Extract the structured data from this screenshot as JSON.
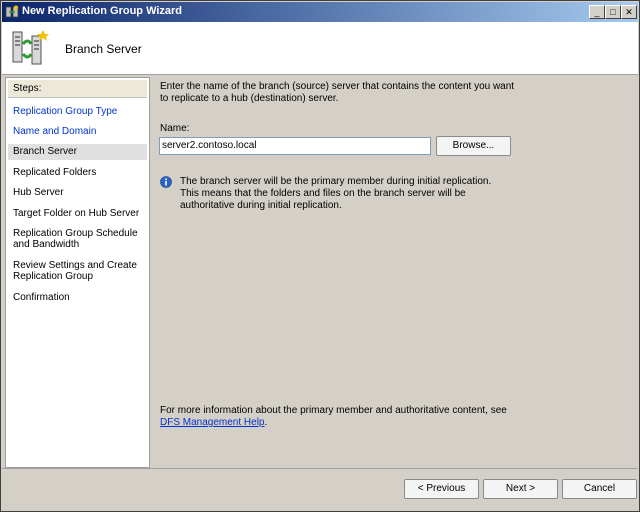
{
  "window": {
    "title": "New Replication Group Wizard",
    "controls": [
      "_",
      "□",
      "✕"
    ]
  },
  "header": {
    "title": "Branch Server",
    "icon": "replication-servers-icon"
  },
  "steps": {
    "heading": "Steps:",
    "items": [
      {
        "label": "Replication Group Type",
        "state": "link"
      },
      {
        "label": "Name and Domain",
        "state": "link"
      },
      {
        "label": "Branch Server",
        "state": "active"
      },
      {
        "label": "Replicated Folders",
        "state": "normal"
      },
      {
        "label": "Hub Server",
        "state": "normal"
      },
      {
        "label": "Target Folder on Hub Server",
        "state": "normal"
      },
      {
        "label": "Replication Group Schedule and Bandwidth",
        "state": "normal"
      },
      {
        "label": "Review Settings and Create Replication Group",
        "state": "normal"
      },
      {
        "label": "Confirmation",
        "state": "normal"
      }
    ]
  },
  "main": {
    "intro": "Enter the name of the branch (source) server that contains the content you want to replicate to a hub (destination) server.",
    "name_label": "Name:",
    "name_value": "server2.contoso.local",
    "browse_label": "Browse...",
    "info_text": "The branch server will be the primary member during initial replication. This means that the folders and files on the branch server will be authoritative during initial replication.",
    "more_info": "For more information about the primary member and authoritative content, see",
    "help_link": "DFS Management Help",
    "help_suffix": "."
  },
  "buttons": {
    "previous": "< Previous",
    "next": "Next >",
    "cancel": "Cancel"
  }
}
